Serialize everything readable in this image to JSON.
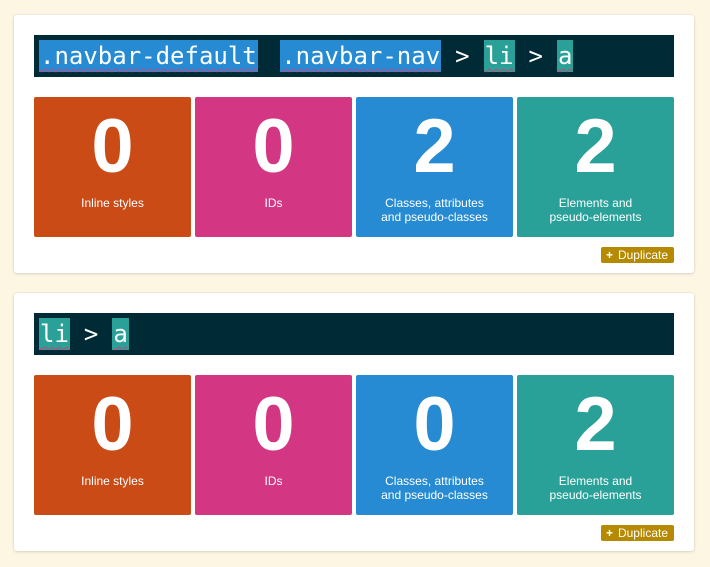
{
  "colors": {
    "background": "#fdf6e3",
    "selector_bar": "#002b36",
    "class_token": "#268bd2",
    "element_token": "#2aa198",
    "inline_tile": "#cb4b16",
    "id_tile": "#d33682",
    "class_tile": "#268bd2",
    "element_tile": "#2aa198",
    "duplicate_button": "#b58900"
  },
  "cards": [
    {
      "selector_tokens": [
        {
          "text": ".navbar-default",
          "kind": "class"
        },
        {
          "text": " ",
          "kind": "space"
        },
        {
          "text": ".navbar-nav",
          "kind": "class"
        },
        {
          "text": ">",
          "kind": "sep"
        },
        {
          "text": "li",
          "kind": "element"
        },
        {
          "text": ">",
          "kind": "sep"
        },
        {
          "text": "a",
          "kind": "element"
        }
      ],
      "tiles": [
        {
          "value": "0",
          "label": "Inline styles"
        },
        {
          "value": "0",
          "label": "IDs"
        },
        {
          "value": "2",
          "label": "Classes, attributes\nand pseudo-classes"
        },
        {
          "value": "2",
          "label": "Elements and\npseudo-elements"
        }
      ],
      "duplicate_icon": "plus-icon",
      "duplicate_label": "Duplicate"
    },
    {
      "selector_tokens": [
        {
          "text": "li",
          "kind": "element"
        },
        {
          "text": ">",
          "kind": "sep"
        },
        {
          "text": "a",
          "kind": "element"
        }
      ],
      "tiles": [
        {
          "value": "0",
          "label": "Inline styles"
        },
        {
          "value": "0",
          "label": "IDs"
        },
        {
          "value": "0",
          "label": "Classes, attributes\nand pseudo-classes"
        },
        {
          "value": "2",
          "label": "Elements and\npseudo-elements"
        }
      ],
      "duplicate_icon": "plus-icon",
      "duplicate_label": "Duplicate"
    }
  ]
}
